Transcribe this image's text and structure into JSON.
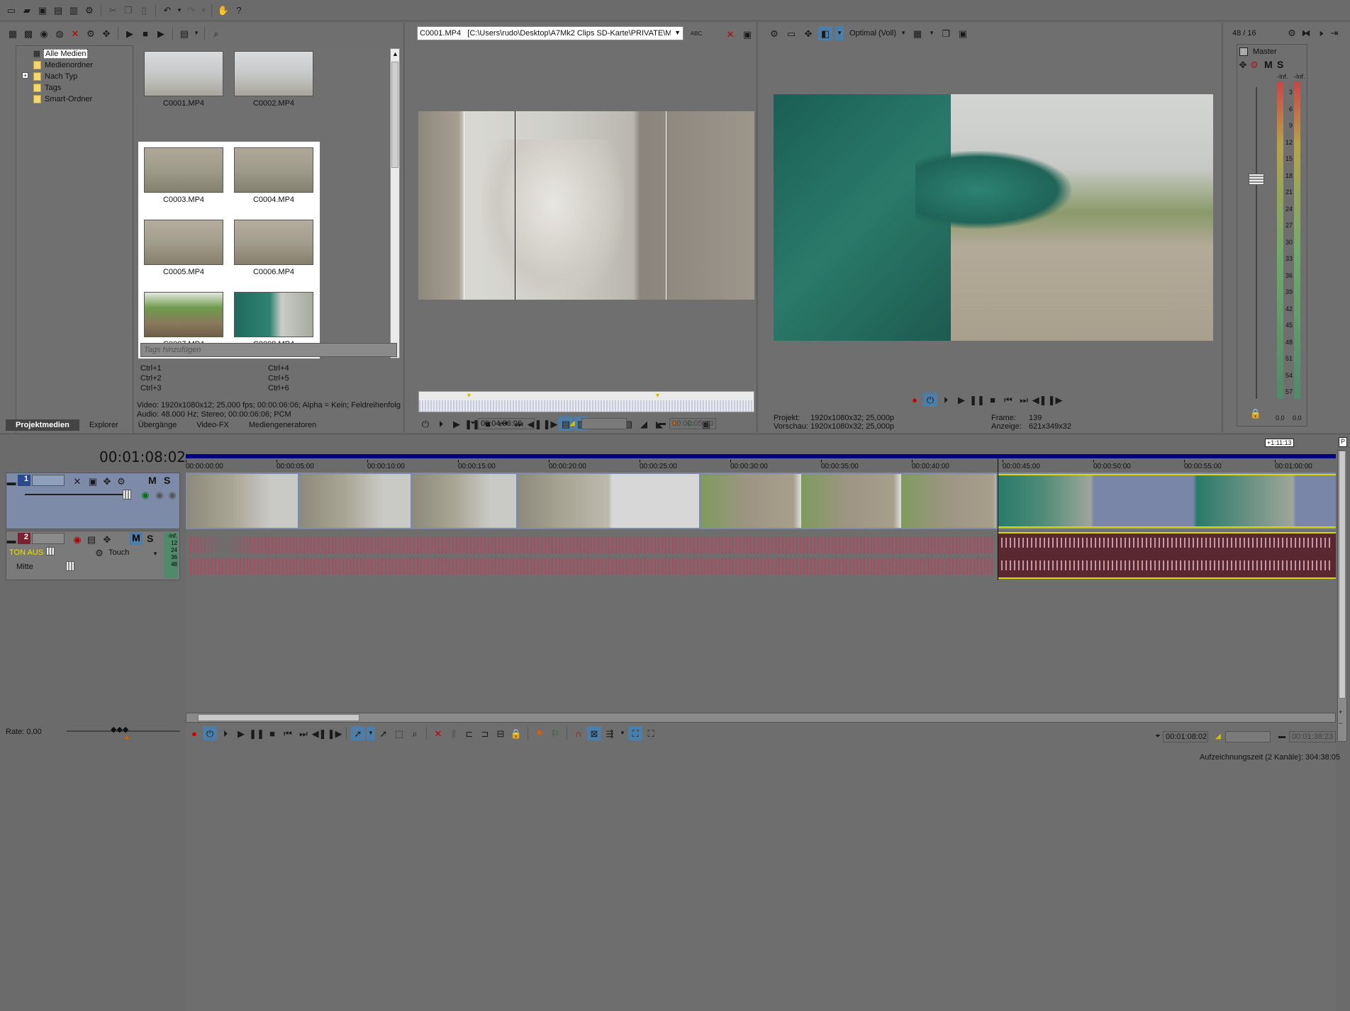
{
  "colors": {
    "accent": "#4d7ea8",
    "timeline_bar": "#000080",
    "audio_clip": "#8b2535",
    "audio_wave": "#c0506a",
    "selection": "#d8d800"
  },
  "toolbar": {
    "icons": [
      "new-icon",
      "open-icon",
      "save-icon",
      "save-as-icon",
      "render-icon",
      "properties-icon",
      "cut-icon",
      "copy-icon",
      "paste-icon",
      "undo-icon",
      "redo-icon",
      "plugin-icon",
      "help-icon"
    ]
  },
  "media": {
    "tree": [
      "Alle Medien",
      "Medienordner",
      "Nach Typ",
      "Tags",
      "Smart-Ordner"
    ],
    "expander": "+",
    "files": [
      "C0001.MP4",
      "C0002.MP4",
      "C0003.MP4",
      "C0004.MP4",
      "C0005.MP4",
      "C0006.MP4",
      "C0007.MP4",
      "C0008.MP4"
    ],
    "tags_placeholder": "Tags hinzufügen",
    "shortcuts": [
      "Ctrl+1",
      "Ctrl+4",
      "Ctrl+2",
      "Ctrl+5",
      "Ctrl+3",
      "Ctrl+6"
    ],
    "info_video": "Video: 1920x1080x12; 25,000 fps; 00:00:06:06; Alpha = Kein; Feldreihenfolg",
    "info_audio": "Audio: 48.000 Hz; Stereo; 00:00:06:06; PCM",
    "tabs": [
      "Projektmedien",
      "Explorer",
      "Übergänge",
      "Video-FX",
      "Mediengeneratoren"
    ]
  },
  "trimmer": {
    "file": "C0001.MP4   [C:\\Users\\rudo\\Desktop\\A7Mk2 Clips SD-Karte\\PRIVATE\\M",
    "time_in": "00:04:36:06",
    "time_len": "00:00:05:20"
  },
  "preview": {
    "quality": "Optimal (Voll)",
    "projekt_label": "Projekt:",
    "projekt_value": "1920x1080x32; 25,000p",
    "vorschau_label": "Vorschau:",
    "vorschau_value": "1920x1080x32; 25,000p",
    "frame_label": "Frame:",
    "frame_value": "139",
    "anzeige_label": "Anzeige:",
    "anzeige_value": "621x349x32"
  },
  "master": {
    "count": "48 / 16",
    "title": "Master",
    "m": "M",
    "s": "S",
    "inf_l": "-Inf.",
    "inf_r": "-Inf.",
    "ticks": [
      "3",
      "6",
      "9",
      "12",
      "15",
      "18",
      "21",
      "24",
      "27",
      "30",
      "33",
      "36",
      "39",
      "42",
      "45",
      "48",
      "51",
      "54",
      "57"
    ],
    "bottom_l": "0.0",
    "bottom_r": "0.0"
  },
  "timeline": {
    "timecode": "00:01:08:02",
    "end_marker": "+1:11:13",
    "marks": [
      "00:00:00:00",
      "00:00:05:00",
      "00:00:10:00",
      "00:00:15:00",
      "00:00:20:00",
      "00:00:25:00",
      "00:00:30:00",
      "00:00:35:00",
      "00:00:40:00",
      "00:00:45:00",
      "00:00:50:00",
      "00:00:55:00",
      "00:01:00:00"
    ],
    "track1": {
      "num": "1",
      "m": "M",
      "s": "S"
    },
    "track2": {
      "num": "2",
      "m": "M",
      "s": "S",
      "mute": "TON AUS",
      "mode": "Touch",
      "pan": "Mitte",
      "meter": [
        "-Inf.",
        "12",
        "24",
        "36",
        "48"
      ]
    },
    "rate": "Rate: 0,00",
    "cursor_time": "00:01:08:02",
    "end_time": "00:01:38:23",
    "status": "Aufzeichnungszeit (2 Kanäle): 304:38:05"
  }
}
